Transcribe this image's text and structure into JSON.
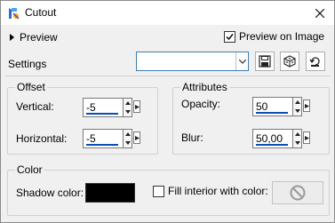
{
  "window": {
    "title": "Cutout"
  },
  "preview": {
    "toggle_label": "Preview",
    "on_image_label": "Preview on Image",
    "on_image_checked": true
  },
  "settings": {
    "label": "Settings",
    "selected": ""
  },
  "offset": {
    "title": "Offset",
    "vertical_label": "Vertical:",
    "vertical_value": "-5",
    "horizontal_label": "Horizontal:",
    "horizontal_value": "-5"
  },
  "attributes": {
    "title": "Attributes",
    "opacity_label": "Opacity:",
    "opacity_value": "50",
    "blur_label": "Blur:",
    "blur_value": "50,00"
  },
  "color": {
    "title": "Color",
    "shadow_label": "Shadow color:",
    "shadow_color": "#000000",
    "fill_label": "Fill interior with color:",
    "fill_checked": false
  },
  "icons": [
    "app-icon",
    "close-icon",
    "save-icon",
    "randomize-icon",
    "reset-icon",
    "no-color-icon"
  ]
}
